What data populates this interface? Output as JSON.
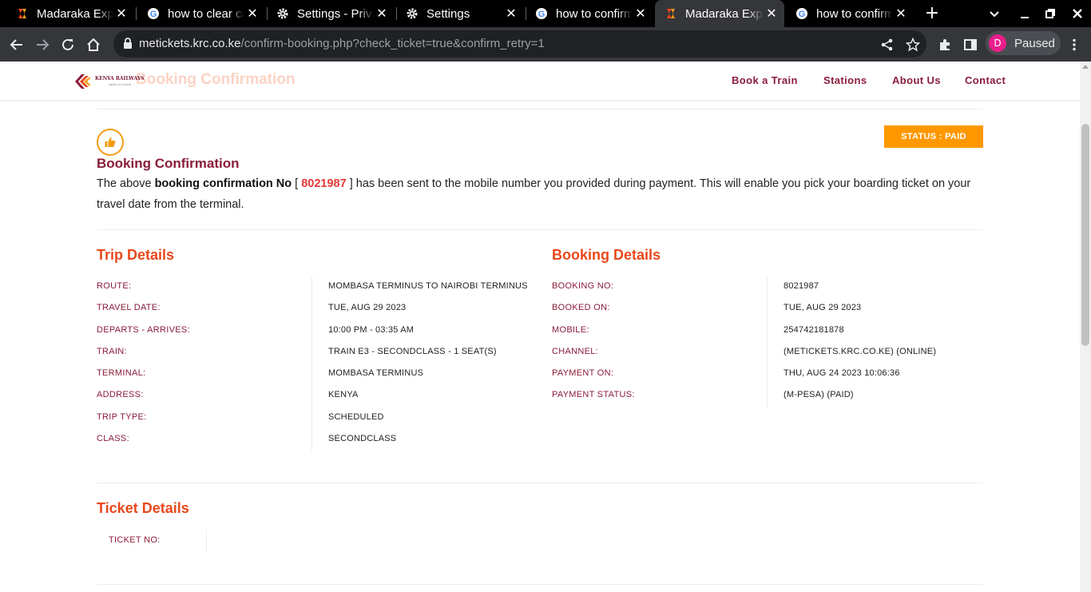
{
  "browser": {
    "tabs": [
      {
        "title": "Madaraka Express",
        "favicon": "madaraka-logo-icon",
        "active": false
      },
      {
        "title": "how to clear cache",
        "favicon": "google-icon",
        "active": false
      },
      {
        "title": "Settings - Privacy",
        "favicon": "gear-icon",
        "active": false
      },
      {
        "title": "Settings",
        "favicon": "gear-icon",
        "active": false
      },
      {
        "title": "how to confirm",
        "favicon": "google-icon",
        "active": false
      },
      {
        "title": "Madaraka Express",
        "favicon": "madaraka-logo-icon",
        "active": true
      },
      {
        "title": "how to confirm",
        "favicon": "google-icon",
        "active": false
      }
    ],
    "url_host": "metickets.krc.co.ke",
    "url_path": "/confirm-booking.php?check_ticket=true&confirm_retry=1",
    "profile_initial": "D",
    "profile_label": "Paused"
  },
  "site": {
    "logo_text": "KENYA RAILWAYS",
    "logo_tagline": "right on track",
    "ghost_title": "Booking Confirmation",
    "nav": [
      "Book a Train",
      "Stations",
      "About Us",
      "Contact"
    ]
  },
  "confirmation": {
    "status": "STATUS : PAID",
    "title": "Booking Confirmation",
    "text_pre": "The above ",
    "text_bold": "booking confirmation No",
    "bracket_open": " [ ",
    "booking_no": "8021987",
    "bracket_close": " ]",
    "text_post": " has been sent to the mobile number you provided during payment. This will enable you pick your boarding ticket on your travel date from the terminal."
  },
  "trip_details": {
    "title": "Trip Details",
    "rows": [
      {
        "label": "ROUTE:",
        "value": "MOMBASA TERMINUS TO NAIROBI TERMINUS"
      },
      {
        "label": "TRAVEL DATE:",
        "value": "TUE, AUG 29 2023"
      },
      {
        "label": "DEPARTS - ARRIVES:",
        "value": "10:00 PM - 03:35 AM"
      },
      {
        "label": "TRAIN:",
        "value": "TRAIN E3 - SECONDCLASS - 1 SEAT(S)"
      },
      {
        "label": "TERMINAL:",
        "value": "MOMBASA TERMINUS"
      },
      {
        "label": "ADDRESS:",
        "value": "KENYA"
      },
      {
        "label": "TRIP TYPE:",
        "value": "SCHEDULED"
      },
      {
        "label": "CLASS:",
        "value": "SECONDCLASS"
      }
    ]
  },
  "booking_details": {
    "title": "Booking Details",
    "rows": [
      {
        "label": "BOOKING NO:",
        "value": "8021987"
      },
      {
        "label": "BOOKED ON:",
        "value": "TUE, AUG 29 2023"
      },
      {
        "label": "MOBILE:",
        "value": "254742181878"
      },
      {
        "label": "CHANNEL:",
        "value": "(METICKETS.KRC.CO.KE) (ONLINE)"
      },
      {
        "label": "PAYMENT ON:",
        "value": "THU, AUG 24 2023 10:06:36"
      },
      {
        "label": "PAYMENT STATUS:",
        "value": "(M-PESA) (PAID)"
      }
    ]
  },
  "ticket_details": {
    "title": "Ticket Details",
    "rows": [
      {
        "label": "TICKET NO:",
        "value": ""
      }
    ]
  },
  "colors": {
    "brand_maroon": "#8a1c3a",
    "section_orange": "#e8481c",
    "status_orange": "#ff9800",
    "booking_no_red": "#e53935"
  }
}
